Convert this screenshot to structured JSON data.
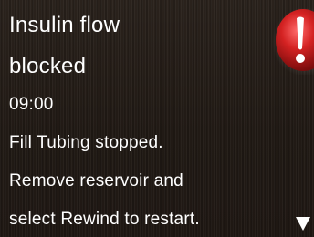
{
  "alert": {
    "title_line1": "Insulin flow",
    "title_line2": "blocked",
    "time": "09:00",
    "message_lines": [
      "Fill Tubing stopped.",
      "Remove reservoir and",
      "select Rewind to restart."
    ]
  },
  "icons": {
    "alert_icon": "red-exclamation-alert-icon",
    "scroll_indicator": "triangle-down-icon"
  },
  "colors": {
    "background": "#231c17",
    "text": "#ffffff",
    "alert_red": "#d32020"
  }
}
